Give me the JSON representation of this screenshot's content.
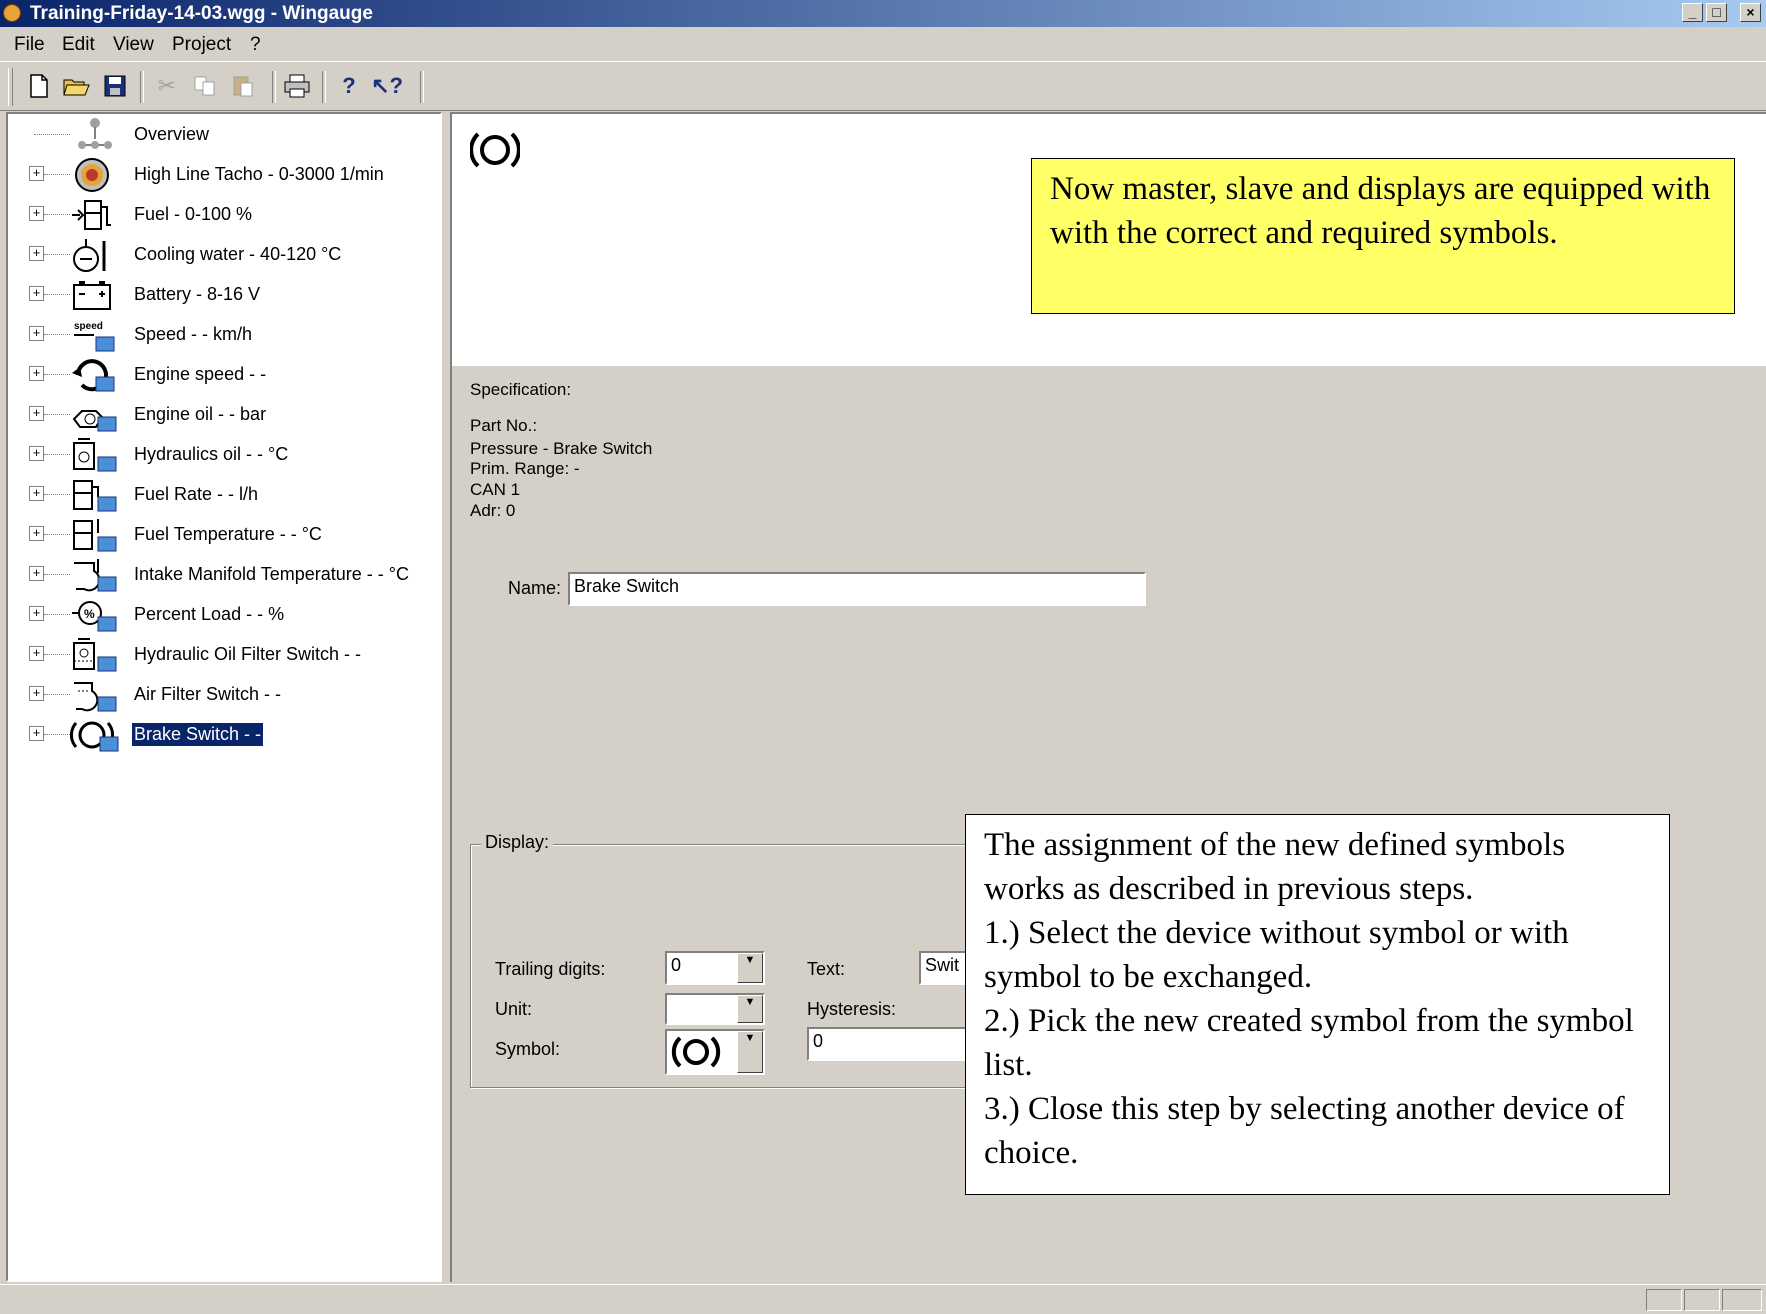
{
  "window": {
    "title": "Training-Friday-14-03.wgg - Wingauge",
    "minimize": "_",
    "maximize": "□",
    "close": "×"
  },
  "menu": [
    "File",
    "Edit",
    "View",
    "Project",
    "?"
  ],
  "toolbar": {
    "buttons": [
      "new-icon",
      "open-icon",
      "save-icon",
      "cut-icon",
      "copy-icon",
      "paste-icon",
      "print-icon",
      "help-icon",
      "context-help-icon"
    ]
  },
  "tree": {
    "items": [
      {
        "label": "Overview",
        "icon": "overview-icon"
      },
      {
        "label": "High Line Tacho - 0-3000 1/min",
        "icon": "tacho-icon"
      },
      {
        "label": "Fuel - 0-100 %",
        "icon": "fuel-icon"
      },
      {
        "label": "Cooling water - 40-120 °C",
        "icon": "cooling-water-icon"
      },
      {
        "label": "Battery - 8-16 V",
        "icon": "battery-icon"
      },
      {
        "label": "Speed - - km/h",
        "icon": "speed-icon"
      },
      {
        "label": "Engine speed - -",
        "icon": "engine-speed-icon"
      },
      {
        "label": "Engine oil - - bar",
        "icon": "engine-oil-icon"
      },
      {
        "label": "Hydraulics oil - - °C",
        "icon": "hydraulics-oil-icon"
      },
      {
        "label": "Fuel Rate - - l/h",
        "icon": "fuel-rate-icon"
      },
      {
        "label": "Fuel Temperature - - °C",
        "icon": "fuel-temperature-icon"
      },
      {
        "label": "Intake Manifold Temperature - - °C",
        "icon": "intake-manifold-icon"
      },
      {
        "label": "Percent Load - - %",
        "icon": "percent-load-icon"
      },
      {
        "label": "Hydraulic Oil Filter Switch - -",
        "icon": "hydraulic-filter-icon"
      },
      {
        "label": "Air Filter Switch - -",
        "icon": "air-filter-icon"
      },
      {
        "label": "Brake Switch - -",
        "icon": "brake-switch-icon",
        "selected": true
      }
    ]
  },
  "notes": {
    "yellow": "Now master, slave and displays are equipped  with with the correct and required symbols.",
    "white": [
      "The assignment of the new defined symbols works as described in previous steps.",
      "1.) Select the device without symbol or with symbol to be exchanged.",
      "2.) Pick the new created symbol from the symbol list.",
      "3.) Close this step by selecting another device of choice."
    ]
  },
  "specification": {
    "heading": "Specification:",
    "part_no": "Part No.:",
    "type": "Pressure - Brake Switch",
    "prim_range": "Prim. Range: -",
    "can": "CAN 1",
    "adr": "Adr: 0"
  },
  "name_field": {
    "label": "Name:",
    "value": "Brake Switch"
  },
  "display": {
    "title": "Display:",
    "trailing_digits_label": "Trailing digits:",
    "trailing_digits_value": "0",
    "unit_label": "Unit:",
    "unit_value": "",
    "symbol_label": "Symbol:",
    "symbol_value": "brake-symbol-icon",
    "text_label": "Text:",
    "text_value": "Swit",
    "hysteresis_label": "Hysteresis:",
    "hysteresis_value": "0"
  }
}
